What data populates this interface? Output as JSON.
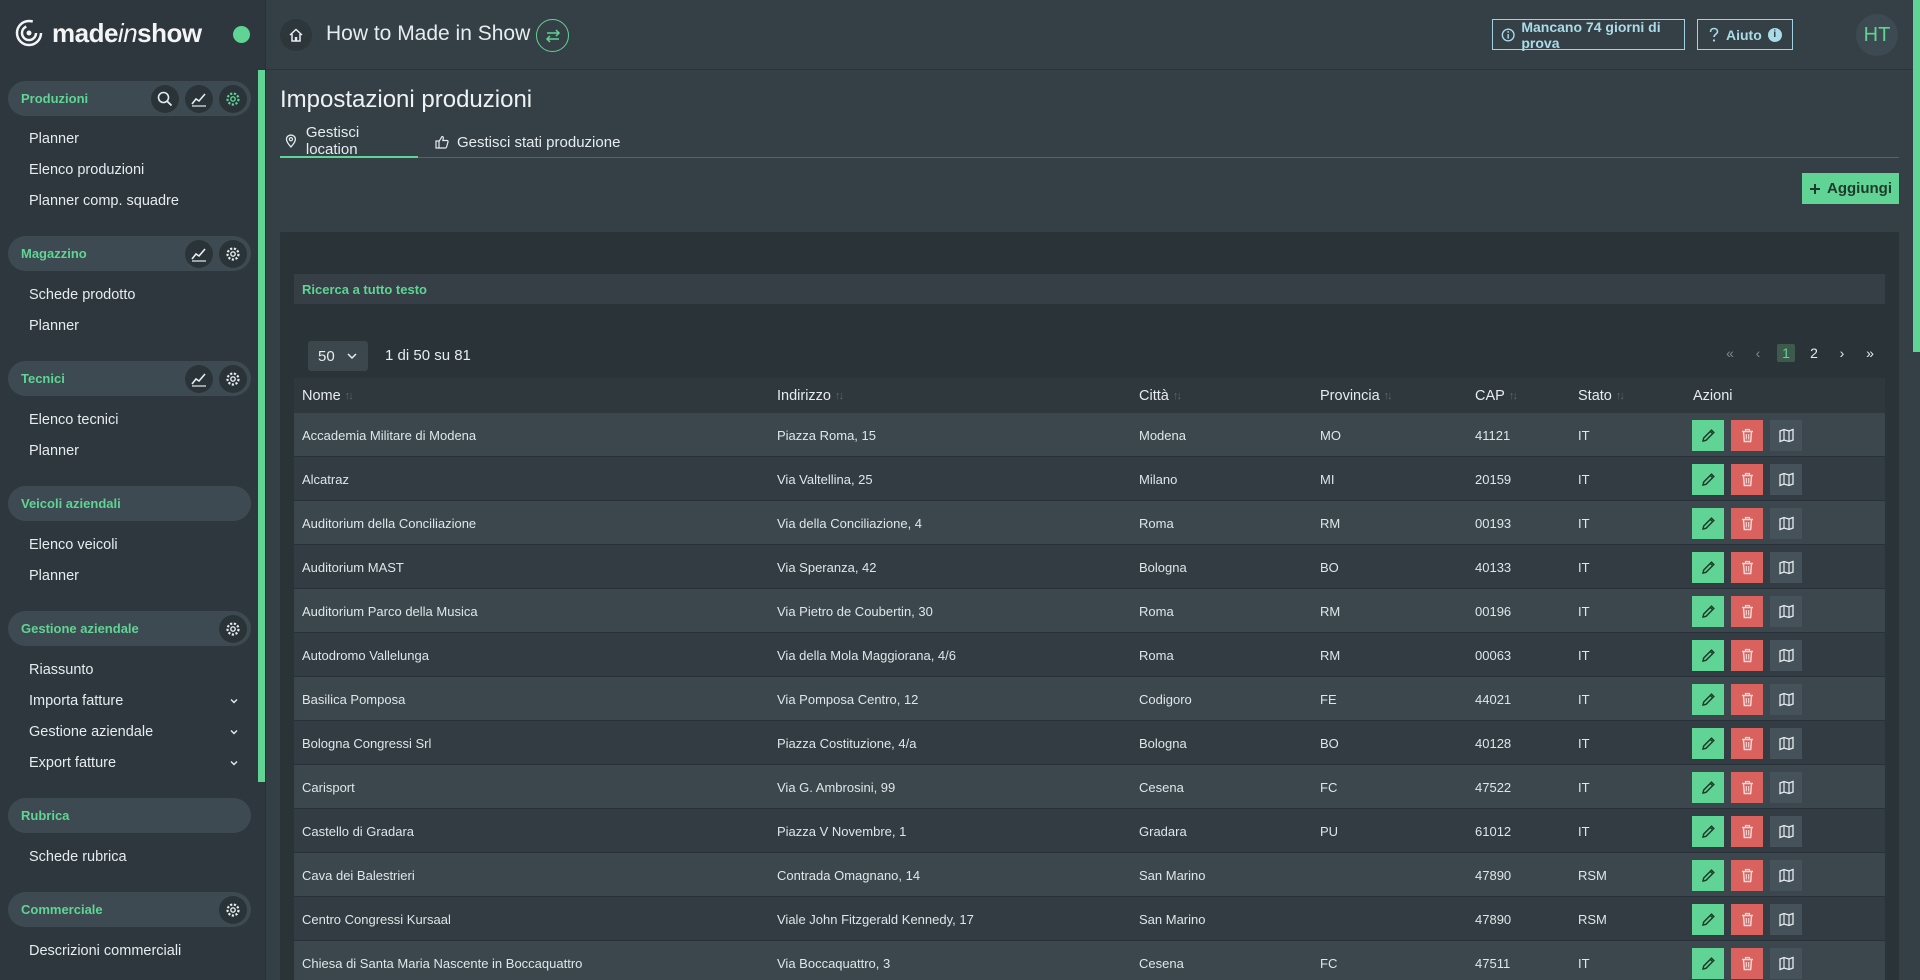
{
  "brand": {
    "name_prefix": "made",
    "name_italic": "in",
    "name_suffix": "show"
  },
  "sidebar": {
    "sections": [
      {
        "title": "Produzioni",
        "items": [
          "Planner",
          "Elenco produzioni",
          "Planner comp. squadre"
        ]
      },
      {
        "title": "Magazzino",
        "items": [
          "Schede prodotto",
          "Planner"
        ]
      },
      {
        "title": "Tecnici",
        "items": [
          "Elenco tecnici",
          "Planner"
        ]
      },
      {
        "title": "Veicoli aziendali",
        "items": [
          "Elenco veicoli",
          "Planner"
        ]
      },
      {
        "title": "Gestione aziendale",
        "items": [
          "Riassunto",
          "Importa fatture",
          "Gestione aziendale",
          "Export fatture"
        ]
      },
      {
        "title": "Rubrica",
        "items": [
          "Schede rubrica"
        ]
      },
      {
        "title": "Commerciale",
        "items": [
          "Descrizioni commerciali"
        ]
      }
    ]
  },
  "topbar": {
    "title": "How to Made in Show",
    "trial": "Mancano 74 giorni di prova",
    "help": "Aiuto",
    "help_badge": "i",
    "avatar": "HT"
  },
  "page": {
    "title": "Impostazioni produzioni",
    "tabs": [
      "Gestisci location",
      "Gestisci stati produzione"
    ],
    "add_label": "Aggiungi",
    "search_label": "Ricerca a tutto testo",
    "per_page": "50",
    "range": "1 di 50 su 81",
    "pages": [
      "1",
      "2"
    ]
  },
  "table": {
    "columns": [
      "Nome",
      "Indirizzo",
      "Città",
      "Provincia",
      "CAP",
      "Stato",
      "Azioni"
    ],
    "rows": [
      [
        "Accademia Militare di Modena",
        "Piazza Roma, 15",
        "Modena",
        "MO",
        "41121",
        "IT"
      ],
      [
        "Alcatraz",
        "Via Valtellina, 25",
        "Milano",
        "MI",
        "20159",
        "IT"
      ],
      [
        "Auditorium della Conciliazione",
        "Via della Conciliazione, 4",
        "Roma",
        "RM",
        "00193",
        "IT"
      ],
      [
        "Auditorium MAST",
        "Via Speranza, 42",
        "Bologna",
        "BO",
        "40133",
        "IT"
      ],
      [
        "Auditorium Parco della Musica",
        "Via Pietro de Coubertin, 30",
        "Roma",
        "RM",
        "00196",
        "IT"
      ],
      [
        "Autodromo Vallelunga",
        "Via della Mola Maggiorana, 4/6",
        "Roma",
        "RM",
        "00063",
        "IT"
      ],
      [
        "Basilica Pomposa",
        "Via Pomposa Centro, 12",
        "Codigoro",
        "FE",
        "44021",
        "IT"
      ],
      [
        "Bologna Congressi Srl",
        "Piazza Costituzione, 4/a",
        "Bologna",
        "BO",
        "40128",
        "IT"
      ],
      [
        "Carisport",
        "Via G. Ambrosini, 99",
        "Cesena",
        "FC",
        "47522",
        "IT"
      ],
      [
        "Castello di Gradara",
        "Piazza V Novembre, 1",
        "Gradara",
        "PU",
        "61012",
        "IT"
      ],
      [
        "Cava dei Balestrieri",
        "Contrada Omagnano, 14",
        "San Marino",
        "",
        "47890",
        "RSM"
      ],
      [
        "Centro Congressi Kursaal",
        "Viale John Fitzgerald Kennedy, 17",
        "San Marino",
        "",
        "47890",
        "RSM"
      ],
      [
        "Chiesa di Santa Maria Nascente in Boccaquattro",
        "Via Boccaquattro, 3",
        "Cesena",
        "FC",
        "47511",
        "IT"
      ]
    ]
  },
  "colors": {
    "accent": "#5fd494",
    "danger": "#d9625e",
    "info": "#a9dbe9",
    "bg": "#354046"
  }
}
